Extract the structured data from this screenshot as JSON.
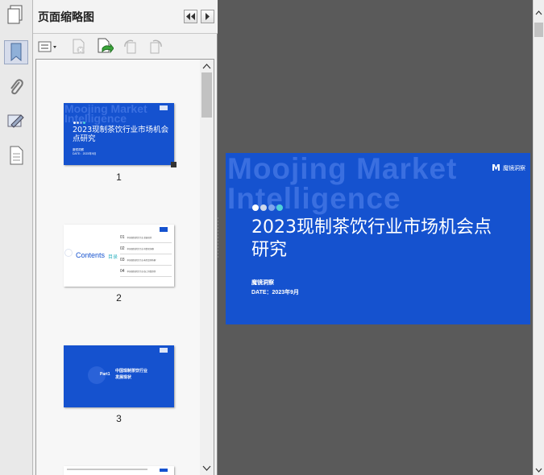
{
  "panel": {
    "title": "页面缩略图"
  },
  "thumbnails": [
    {
      "page": "1",
      "watermark_1": "Moojing Market",
      "watermark_2": "Intelligence",
      "title": "2023现制茶饮行业市场机会点研究",
      "org": "魔镜洞察",
      "date": "DATE：2023年9月"
    },
    {
      "page": "2",
      "contents_label": "Contents",
      "contents_cn": "目录",
      "items": [
        {
          "num": "01",
          "text": "中国现制茶饮行业-发展现状"
        },
        {
          "num": "02",
          "text": "中国现制茶饮行业-消费者洞察"
        },
        {
          "num": "03",
          "text": "中国现制茶饮行业-典型案例拆解"
        },
        {
          "num": "04",
          "text": "中国现制茶饮行业-线上消费趋势"
        }
      ]
    },
    {
      "page": "3",
      "part": "Part1",
      "heading_1": "中国现制茶饮行业",
      "heading_2": "发展现状"
    }
  ],
  "slide": {
    "watermark_1": "Moojing Market",
    "watermark_2": "Intelligence",
    "title": "2023现制茶饮行业市场机会点研究",
    "org": "魔镜洞察",
    "date": "DATE：2023年9月",
    "logo_text": "魔镜洞察",
    "logo_mark": "M",
    "dot_colors": [
      "#ffffff",
      "#cfd8ea",
      "#7fa6ec",
      "#4fd1d9"
    ]
  },
  "colors": {
    "slide_blue": "#1552cf",
    "canvas_gray": "#5a5a5a"
  }
}
